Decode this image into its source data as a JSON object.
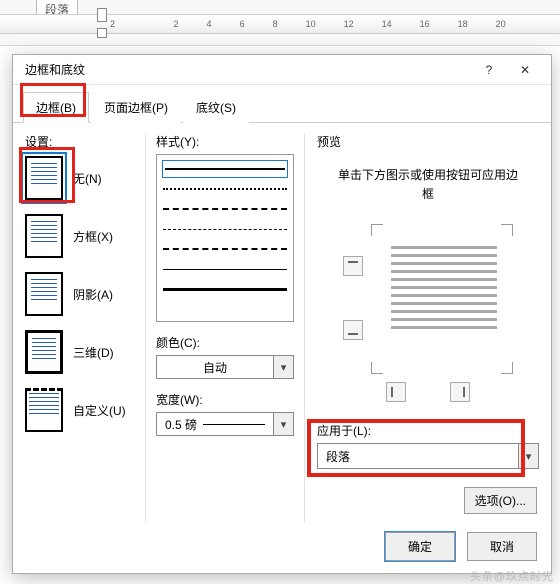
{
  "ruler": {
    "top_label": "段落",
    "ticks": [
      "2",
      "",
      "2",
      "4",
      "6",
      "8",
      "10",
      "12",
      "14",
      "16",
      "18",
      "20"
    ]
  },
  "dialog": {
    "title": "边框和底纹",
    "help": "?",
    "close": "✕",
    "tabs": {
      "border": "边框(B)",
      "page_border": "页面边框(P)",
      "shading": "底纹(S)"
    },
    "settings": {
      "label": "设置:",
      "none": "无(N)",
      "box": "方框(X)",
      "shadow": "阴影(A)",
      "threeD": "三维(D)",
      "custom": "自定义(U)"
    },
    "style": {
      "label": "样式(Y):",
      "color_label": "颜色(C):",
      "color_value": "自动",
      "width_label": "宽度(W):",
      "width_value": "0.5 磅"
    },
    "preview": {
      "label": "预览",
      "hint": "单击下方图示或使用按钮可应用边框",
      "apply_label": "应用于(L):",
      "apply_value": "段落",
      "options": "选项(O)..."
    },
    "buttons": {
      "ok": "确定",
      "cancel": "取消"
    }
  },
  "watermark": "头条@玖点时光"
}
